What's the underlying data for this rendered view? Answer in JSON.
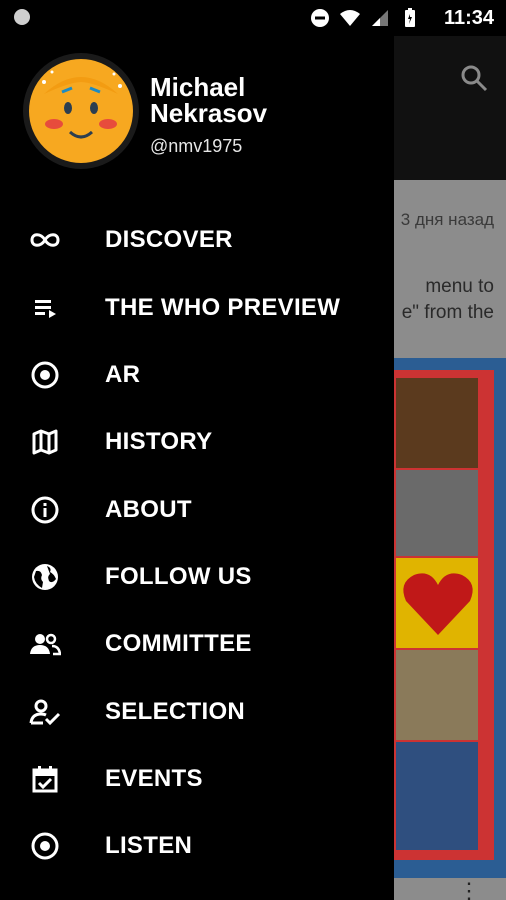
{
  "status_bar": {
    "time": "11:34"
  },
  "profile": {
    "name_line1": "Michael",
    "name_line2": "Nekrasov",
    "handle": "@nmv1975"
  },
  "menu": {
    "items": [
      {
        "label": "DISCOVER",
        "icon": "infinity-icon"
      },
      {
        "label": "THE WHO PREVIEW",
        "icon": "playlist-icon"
      },
      {
        "label": "AR",
        "icon": "target-icon"
      },
      {
        "label": "HISTORY",
        "icon": "map-icon"
      },
      {
        "label": "ABOUT",
        "icon": "info-icon"
      },
      {
        "label": "FOLLOW US",
        "icon": "globe-icon"
      },
      {
        "label": "COMMITTEE",
        "icon": "people-icon"
      },
      {
        "label": "SELECTION",
        "icon": "person-check-icon"
      },
      {
        "label": "EVENTS",
        "icon": "calendar-check-icon"
      },
      {
        "label": "LISTEN",
        "icon": "record-icon"
      }
    ]
  },
  "background": {
    "date": "3 дня назад",
    "line1": "menu to",
    "line2": "e\" from the"
  },
  "colors": {
    "drawer": "#000000",
    "text": "#ffffff",
    "avatar": "#f7a820"
  }
}
